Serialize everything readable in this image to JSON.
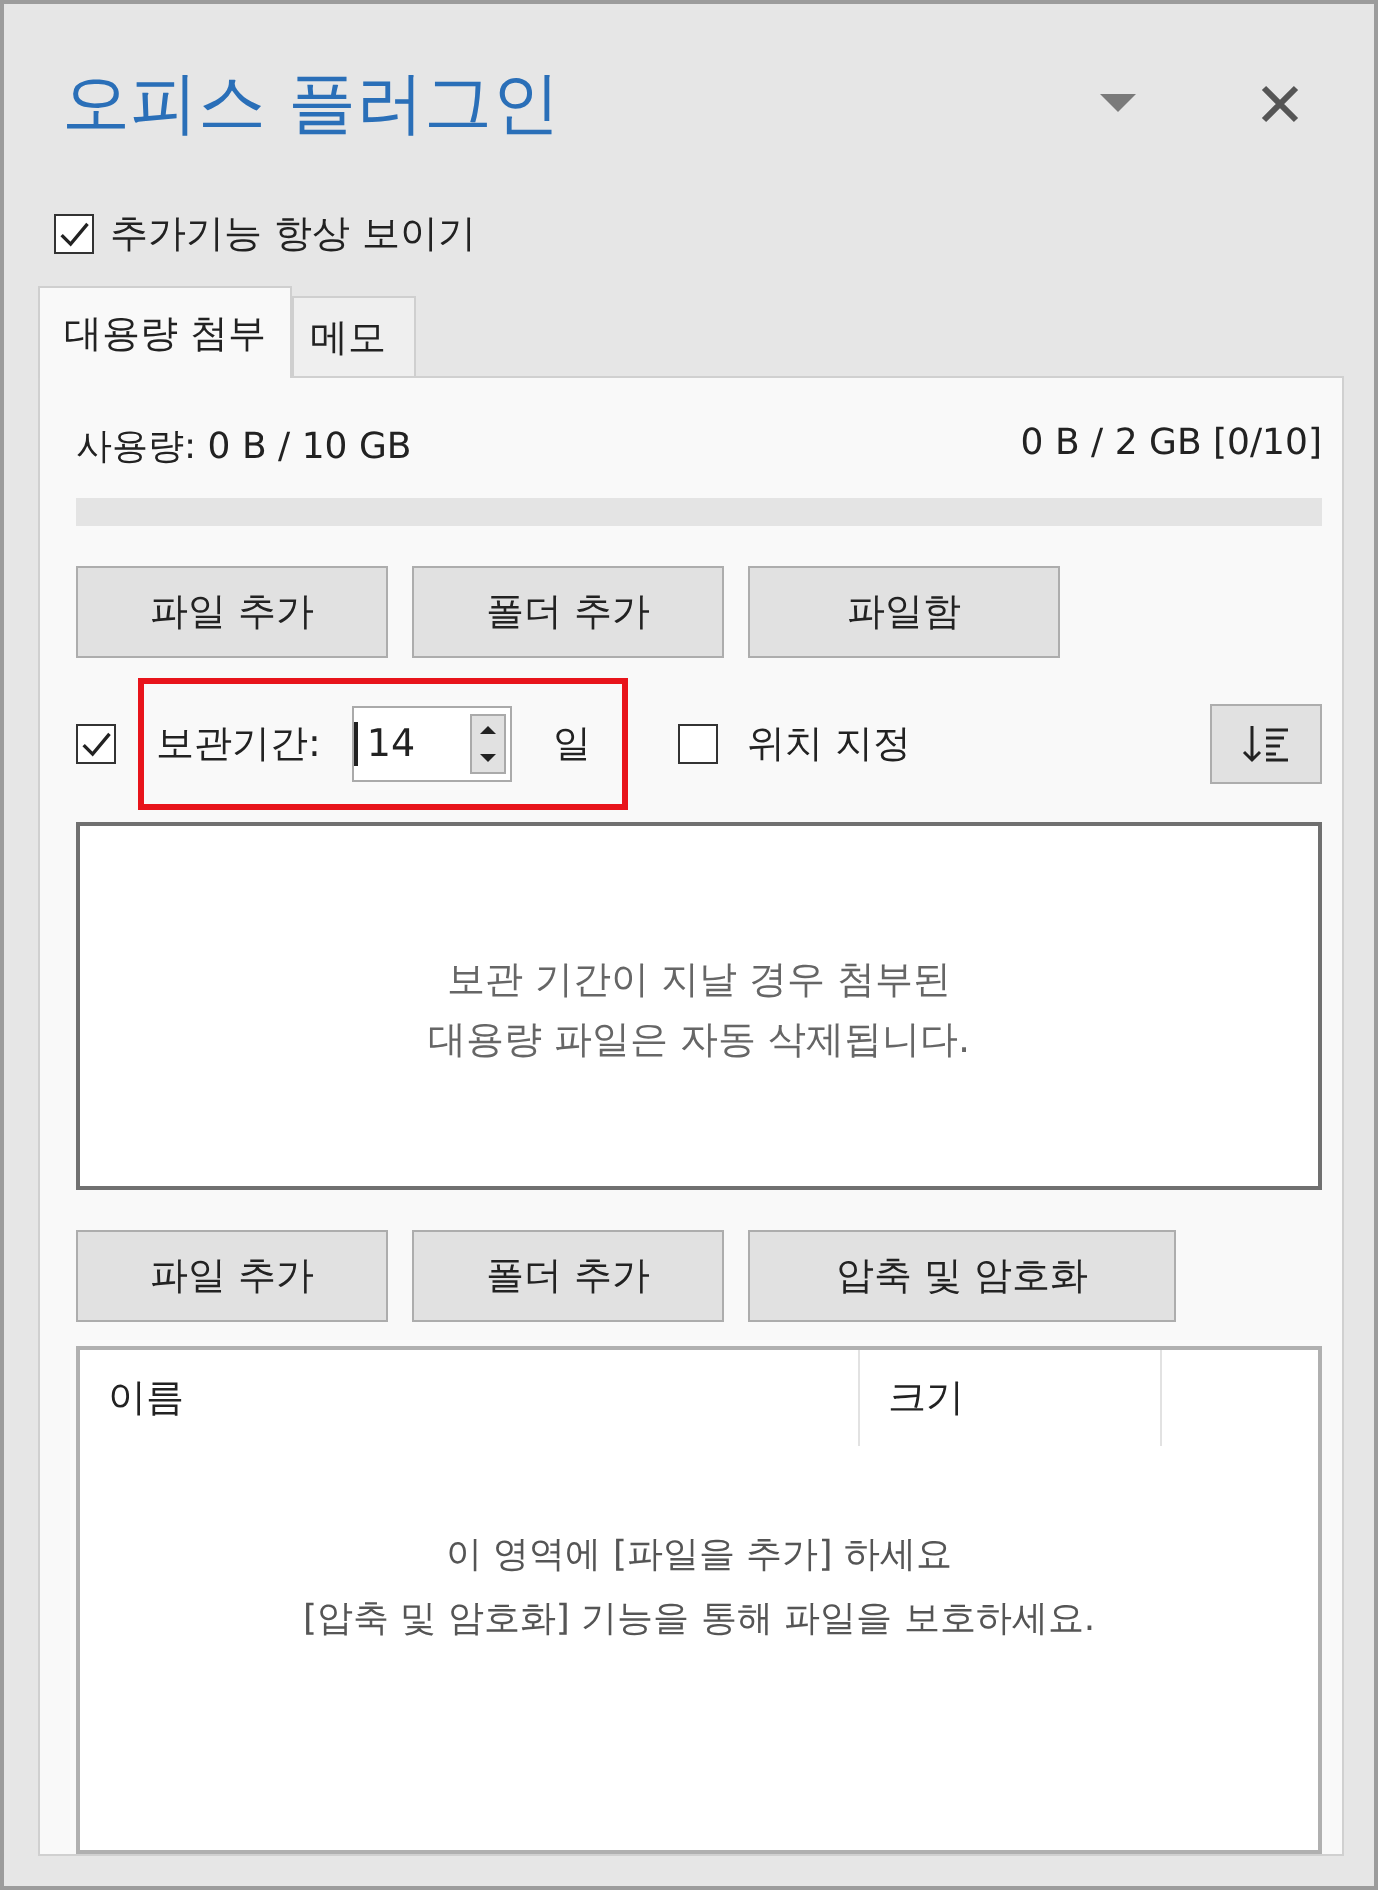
{
  "panel": {
    "title": "오피스 플러그인",
    "always_show": {
      "label": "추가기능 항상 보이기",
      "checked": true
    }
  },
  "tabs": [
    {
      "label": "대용량 첨부",
      "selected": true
    },
    {
      "label": "메모",
      "selected": false
    }
  ],
  "usage": {
    "total": "사용량: 0 B / 10 GB",
    "current": "0 B / 2 GB [0/10]"
  },
  "top_buttons": [
    "파일 추가",
    "폴더 추가",
    "파일함"
  ],
  "retention": {
    "label": "보관기간:",
    "checked": true,
    "value": "14",
    "unit": "일",
    "highlighted": true
  },
  "location": {
    "label": "위치 지정",
    "checked": false
  },
  "notice": "보관 기간이 지날 경우 첨부된\n대용량 파일은 자동 삭제됩니다.",
  "bottom_buttons": [
    "파일 추가",
    "폴더 추가",
    "압축 및 암호화"
  ],
  "file_list": {
    "columns": [
      "이름",
      "크기"
    ],
    "empty_text": "이 영역에 [파일을 추가] 하세요\n[압축 및 암호화] 기능을 통해 파일을 보호하세요."
  }
}
